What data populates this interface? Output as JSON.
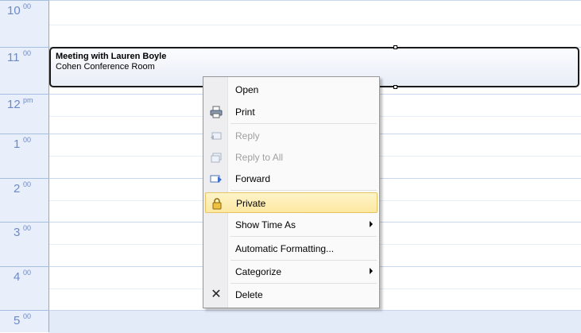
{
  "hours": [
    {
      "h": "10",
      "m": "00"
    },
    {
      "h": "11",
      "m": "00"
    },
    {
      "h": "12",
      "m": "pm"
    },
    {
      "h": "1",
      "m": "00"
    },
    {
      "h": "2",
      "m": "00"
    },
    {
      "h": "3",
      "m": "00"
    },
    {
      "h": "4",
      "m": "00"
    },
    {
      "h": "5",
      "m": "00"
    }
  ],
  "appointment": {
    "title": "Meeting with Lauren Boyle",
    "location": "Cohen Conference Room"
  },
  "menu": {
    "items": [
      {
        "label": "Open",
        "icon": "",
        "disabled": false
      },
      {
        "label": "Print",
        "icon": "printer-icon",
        "disabled": false
      },
      {
        "label": "Reply",
        "icon": "reply-icon",
        "disabled": true
      },
      {
        "label": "Reply to All",
        "icon": "reply-all-icon",
        "disabled": true
      },
      {
        "label": "Forward",
        "icon": "forward-icon",
        "disabled": false
      },
      {
        "label": "Private",
        "icon": "lock-icon",
        "disabled": false,
        "highlighted": true
      },
      {
        "label": "Show Time As",
        "icon": "",
        "disabled": false,
        "submenu": true
      },
      {
        "label": "Automatic Formatting...",
        "icon": "",
        "disabled": false
      },
      {
        "label": "Categorize",
        "icon": "",
        "disabled": false,
        "submenu": true
      },
      {
        "label": "Delete",
        "icon": "delete-x-icon",
        "disabled": false
      }
    ]
  },
  "colors": {
    "time_text": "#6b8ac7",
    "highlight": "#fde8a2",
    "grid_line": "#c9d7ee"
  }
}
